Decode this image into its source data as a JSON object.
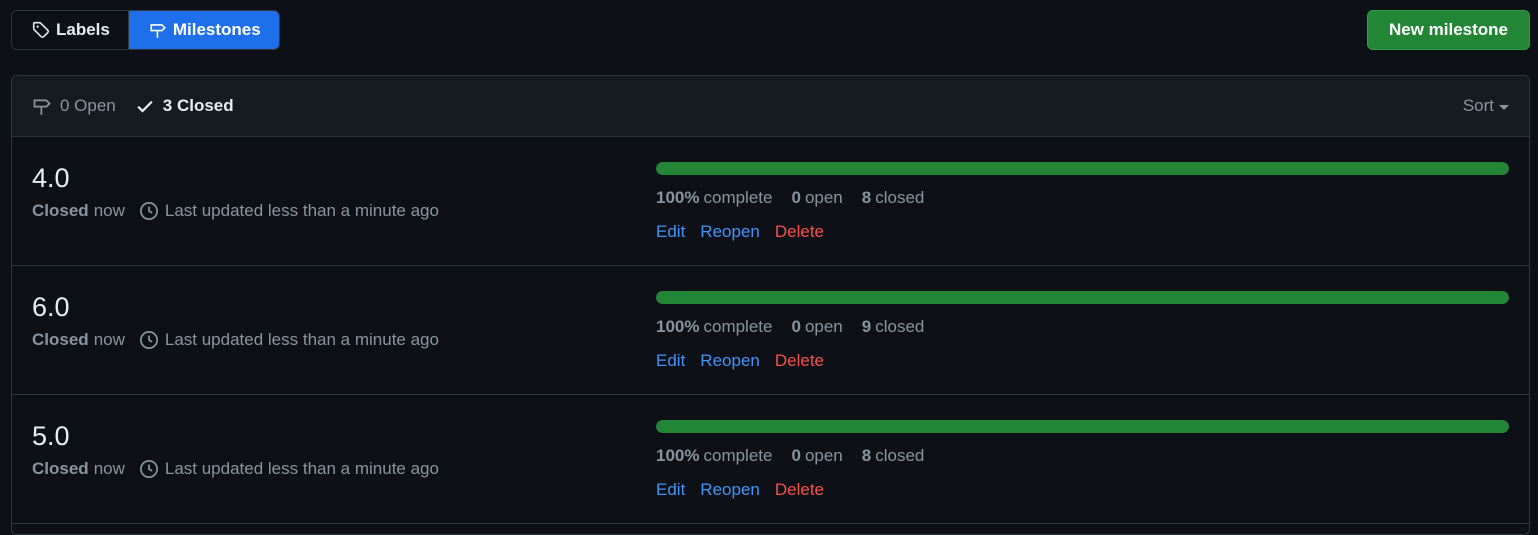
{
  "tabs": {
    "labels": "Labels",
    "milestones": "Milestones"
  },
  "new_button": "New milestone",
  "filter": {
    "open": "0 Open",
    "closed": "3 Closed",
    "sort": "Sort"
  },
  "milestones": [
    {
      "title": "4.0",
      "state": "Closed",
      "when": "now",
      "updated": "Last updated less than a minute ago",
      "percent": "100%",
      "percent_label": "complete",
      "progress": 1.0,
      "open_count": "0",
      "open_label": "open",
      "closed_count": "8",
      "closed_label": "closed",
      "edit": "Edit",
      "reopen": "Reopen",
      "delete": "Delete"
    },
    {
      "title": "6.0",
      "state": "Closed",
      "when": "now",
      "updated": "Last updated less than a minute ago",
      "percent": "100%",
      "percent_label": "complete",
      "progress": 1.0,
      "open_count": "0",
      "open_label": "open",
      "closed_count": "9",
      "closed_label": "closed",
      "edit": "Edit",
      "reopen": "Reopen",
      "delete": "Delete"
    },
    {
      "title": "5.0",
      "state": "Closed",
      "when": "now",
      "updated": "Last updated less than a minute ago",
      "percent": "100%",
      "percent_label": "complete",
      "progress": 1.0,
      "open_count": "0",
      "open_label": "open",
      "closed_count": "8",
      "closed_label": "closed",
      "edit": "Edit",
      "reopen": "Reopen",
      "delete": "Delete"
    }
  ],
  "colors": {
    "background": "#0d1117",
    "accent": "#1f6feb",
    "success": "#238636",
    "link": "#4493f8",
    "danger": "#f85149"
  }
}
